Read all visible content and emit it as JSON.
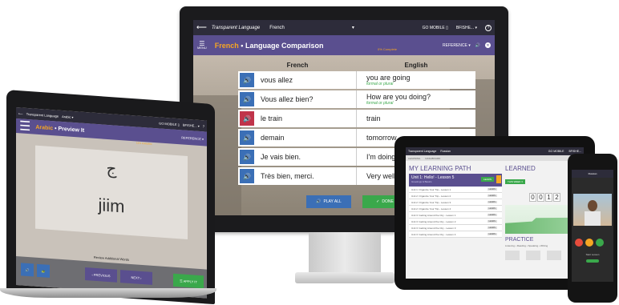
{
  "monitor": {
    "topbar": {
      "back_glyph": "⟵",
      "logo": "Transparent Language",
      "language": "French",
      "chevron": "▾",
      "go_mobile": "GO MOBILE ▯",
      "user": "BFISHE... ▾",
      "help": "?"
    },
    "header": {
      "menu_glyph": "☰",
      "menu_label": "MENU",
      "title_lang": "French",
      "title_sep": " • ",
      "title_rest": "Language Comparison",
      "progress": "0% Complete",
      "reference": "REFERENCE ▾",
      "speaker": "🔊",
      "close": "✕"
    },
    "table": {
      "col_french": "French",
      "col_english": "English",
      "rows": [
        {
          "fr": "vous allez",
          "en": "you are going",
          "note": "formal or plural",
          "active": false
        },
        {
          "fr": "Vous allez bien?",
          "en": "How are you doing?",
          "note": "formal or plural",
          "active": false
        },
        {
          "fr": "le train",
          "en": "train",
          "note": "",
          "active": true
        },
        {
          "fr": "demain",
          "en": "tomorrow",
          "note": "",
          "active": false
        },
        {
          "fr": "Je vais bien.",
          "en": "I'm doing f",
          "note": "",
          "active": false
        },
        {
          "fr": "Très bien, merci.",
          "en": "Very well, t",
          "note": "",
          "active": false
        }
      ],
      "speaker_glyph": "🔊"
    },
    "buttons": {
      "play_all": "PLAY ALL",
      "done": "DONE",
      "play_icon": "🔊",
      "done_icon": "✓"
    }
  },
  "laptop": {
    "topbar": {
      "back_glyph": "⟵",
      "logo": "Transparent Language",
      "language": "Arabic ▾",
      "go_mobile": "GO MOBILE ▯",
      "user": "BFISHE... ▾",
      "help": "?"
    },
    "header": {
      "menu_glyph": "☰",
      "title_lang": "Arabic",
      "title_sep": " • ",
      "title_rest": "Preview It",
      "reference": "REFERENCE ▾",
      "progress": "13% Complete"
    },
    "card": {
      "character": "ج",
      "word": "jiim"
    },
    "caption": "Review Additional Words",
    "buttons": {
      "speaker": "🔊",
      "slow": "🐢",
      "previous": "‹ PREVIOUS",
      "next": "NEXT ›",
      "apply": "☰ APPLY IT"
    }
  },
  "tablet": {
    "topbar": {
      "logo": "Transparent Language",
      "language": "Russian",
      "go_mobile": "GO MOBILE",
      "user": "BFISHE..."
    },
    "sub_tabs": [
      "LEARNING",
      "DASHBOARD"
    ],
    "learning_path": {
      "heading": "MY LEARNING PATH",
      "unit": {
        "title": "Unit 1: Hello! - Lesson 5",
        "subtitle": "Greetings & Basics",
        "learn": "LEARN"
      },
      "lessons": [
        "Unit 1: Organize Your Trip - Lesson 1",
        "Unit 2: Organize Your Trip - Lesson 2",
        "Unit 2: Organize Your Trip - Lesson 3",
        "Unit 2: Organize Your Trip - Lesson 4",
        "Unit 3: Getting Around the City - Lesson 1",
        "Unit 3: Getting Around the City - Lesson 2",
        "Unit 3: Getting Around the City - Lesson 3",
        "Unit 3: Getting Around the City - Lesson 4"
      ],
      "lesson_button": "LEARN"
    },
    "learned": {
      "heading": "LEARNED",
      "filter": "THIS WEEK ▾",
      "digits": [
        "0",
        "0",
        "1",
        "2"
      ]
    },
    "practice": {
      "heading": "PRACTICE",
      "tabs": "Listening • Reading • Speaking • Writing"
    }
  },
  "phone": {
    "topbar": "Russian",
    "label": "Start Lesson"
  }
}
